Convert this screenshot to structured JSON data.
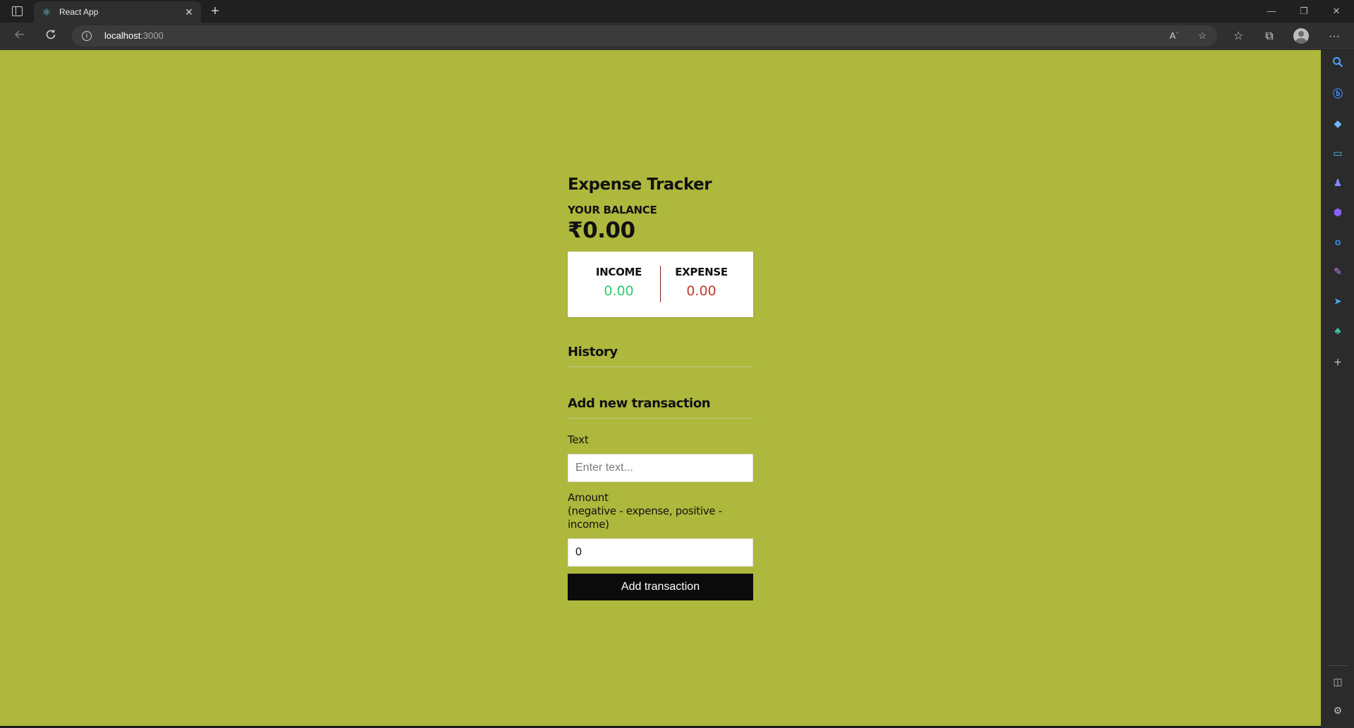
{
  "browser": {
    "tab_title": "React App",
    "url_host": "localhost",
    "url_port": ":3000",
    "window_controls": {
      "minimize": "—",
      "maximize": "❐",
      "close": "✕"
    }
  },
  "app": {
    "title": "Expense Tracker",
    "balance_label": "YOUR BALANCE",
    "balance_value": "₹0.00",
    "income_label": "INCOME",
    "income_value": "0.00",
    "expense_label": "EXPENSE",
    "expense_value": "0.00",
    "history_title": "History",
    "add_title": "Add new transaction",
    "text_label": "Text",
    "text_placeholder": "Enter text...",
    "amount_label": "Amount",
    "amount_hint": "(negative - expense, positive - income)",
    "amount_value": "0",
    "add_button": "Add transaction"
  },
  "sidebar_icons": [
    "search-icon",
    "bing-copilot-icon",
    "shopping-tag-icon",
    "tools-briefcase-icon",
    "games-icon",
    "microsoft-365-icon",
    "outlook-icon",
    "designer-icon",
    "telegram-icon",
    "tree-icon",
    "add-icon",
    "split-screen-icon",
    "settings-icon"
  ],
  "colors": {
    "page_background": "#aeb83d",
    "income": "#2ecc71",
    "expense": "#c0392b",
    "button": "#0b0b0b"
  }
}
